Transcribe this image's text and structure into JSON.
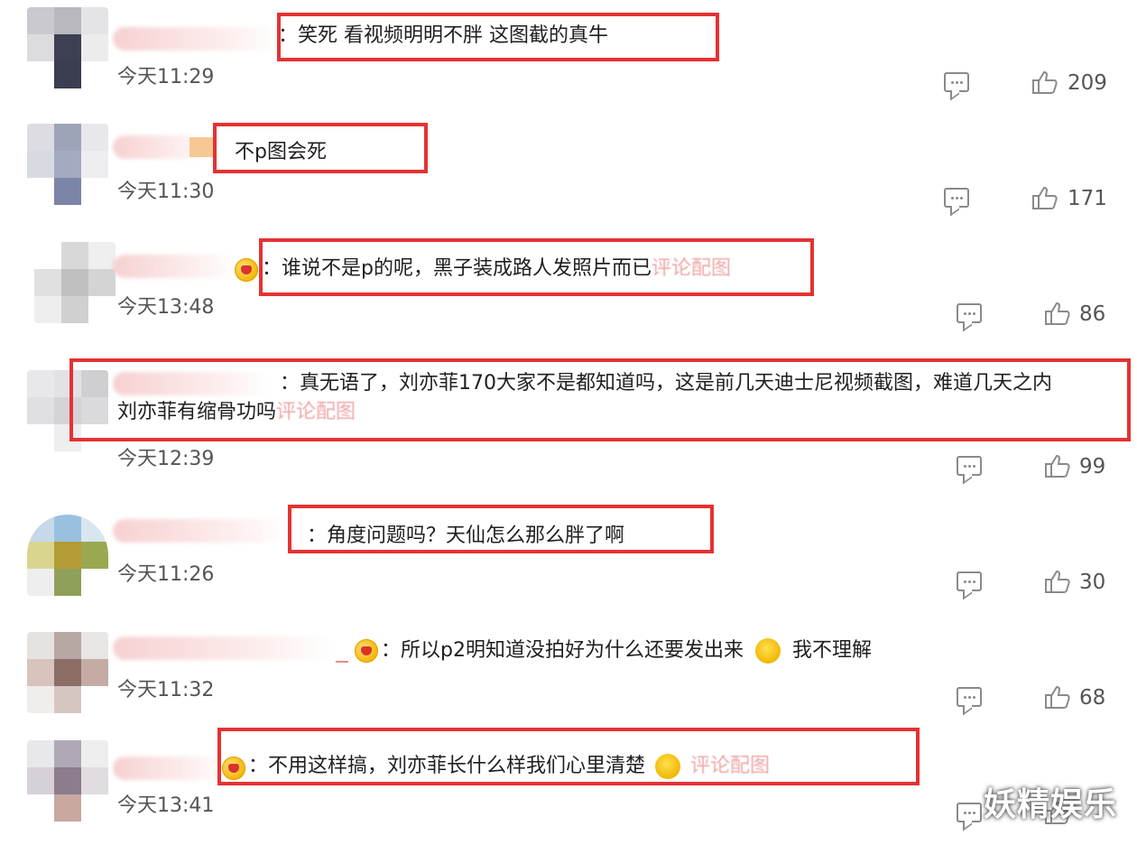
{
  "comments": [
    {
      "text": "：笑死 看视频明明不胖 这图截的真牛",
      "time": "今天11:29",
      "likes": "209",
      "has_badge": false
    },
    {
      "text": "不p图会死",
      "time": "今天11:30",
      "likes": "171",
      "has_badge": false
    },
    {
      "text": "：谁说不是p的呢，黑子装成路人发照片而已",
      "pic_link": "评论配图",
      "time": "今天13:48",
      "likes": "86",
      "has_badge": true
    },
    {
      "text_line1": "：真无语了，刘亦菲170大家不是都知道吗，这是前几天迪士尼视频截图，难道几天之内",
      "text_line2": "刘亦菲有缩骨功吗",
      "pic_link": "评论配图",
      "time": "今天12:39",
      "likes": "99",
      "has_badge": false
    },
    {
      "text": "：角度问题吗？天仙怎么那么胖了啊",
      "time": "今天11:26",
      "likes": "30",
      "has_badge": false
    },
    {
      "text": "：所以p2明知道没拍好为什么还要发出来",
      "text_after": "我不理解",
      "time": "今天11:32",
      "likes": "68",
      "has_badge": true
    },
    {
      "text": "：不用这样搞，刘亦菲长什么样我们心里清楚",
      "pic_link": "评论配图",
      "time": "今天13:41",
      "likes": "",
      "has_badge": true
    }
  ],
  "watermark": "妖精娱乐",
  "icons": {
    "reply": "comment-bubble-icon",
    "like": "thumbs-up-icon"
  },
  "colors": {
    "highlight_box": "#e53232",
    "pic_link": "#f0a6a6",
    "meta_text": "#555555"
  }
}
